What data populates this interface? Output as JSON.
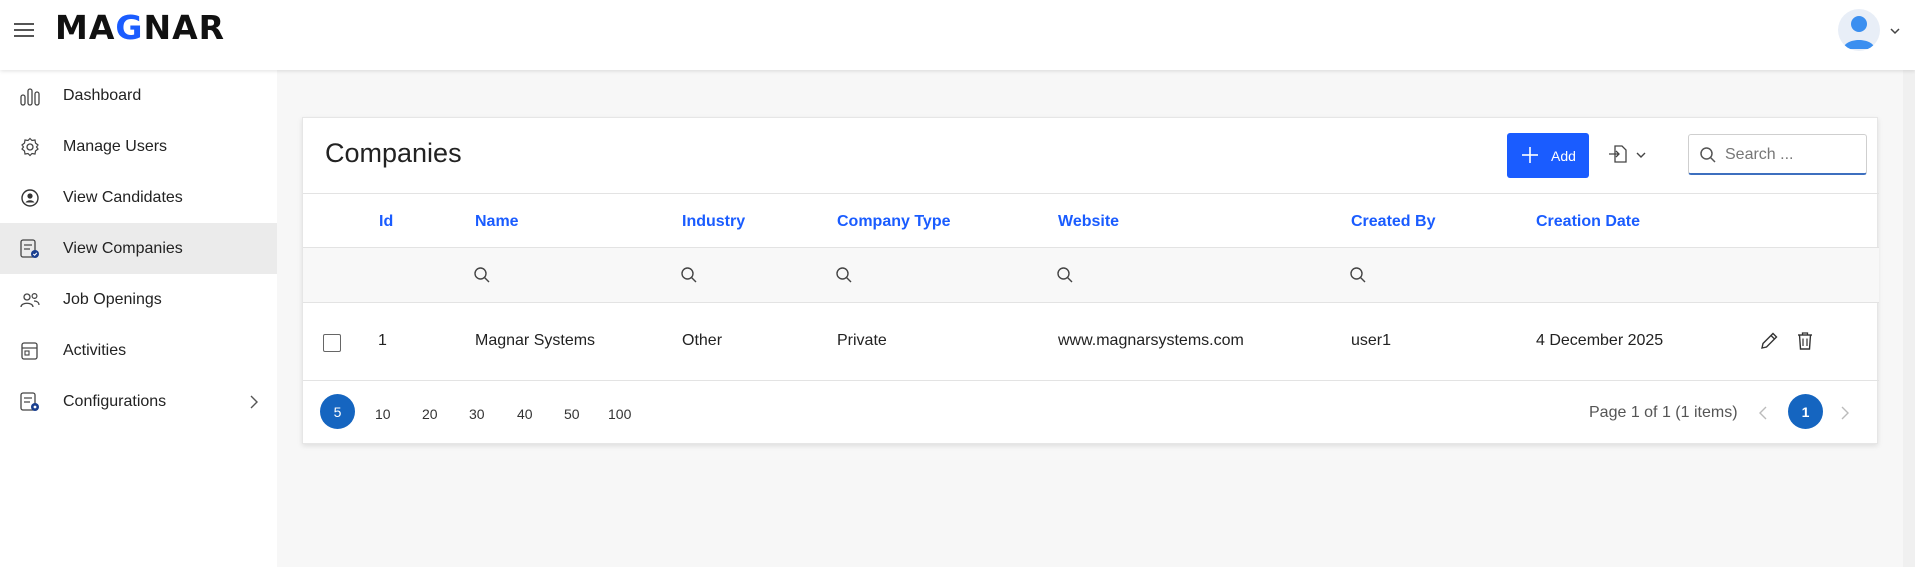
{
  "header": {
    "logo_text_a": "MA",
    "logo_text_g": "G",
    "logo_text_b": "NAR",
    "accent": "#1a5cff"
  },
  "sidebar": {
    "items": [
      {
        "label": "Dashboard",
        "icon": "bar-chart-icon"
      },
      {
        "label": "Manage Users",
        "icon": "gear-icon"
      },
      {
        "label": "View Candidates",
        "icon": "user-circle-icon"
      },
      {
        "label": "View Companies",
        "icon": "company-list-icon",
        "active": true
      },
      {
        "label": "Job Openings",
        "icon": "people-icon"
      },
      {
        "label": "Activities",
        "icon": "calendar-icon"
      },
      {
        "label": "Configurations",
        "icon": "config-icon"
      }
    ]
  },
  "page": {
    "title": "Companies",
    "add_label": "Add",
    "search_placeholder": "Search ..."
  },
  "table": {
    "columns": [
      "Id",
      "Name",
      "Industry",
      "Company Type",
      "Website",
      "Created By",
      "Creation Date"
    ],
    "rows": [
      {
        "id": "1",
        "name": "Magnar Systems",
        "industry": "Other",
        "company_type": "Private",
        "website": "www.magnarsystems.com",
        "created_by": "user1",
        "creation_date": "4 December 2025"
      }
    ]
  },
  "pager": {
    "page_sizes": [
      "5",
      "10",
      "20",
      "30",
      "40",
      "50",
      "100"
    ],
    "selected_page_size": "5",
    "info": "Page 1 of 1 (1 items)",
    "current_page": "1"
  }
}
